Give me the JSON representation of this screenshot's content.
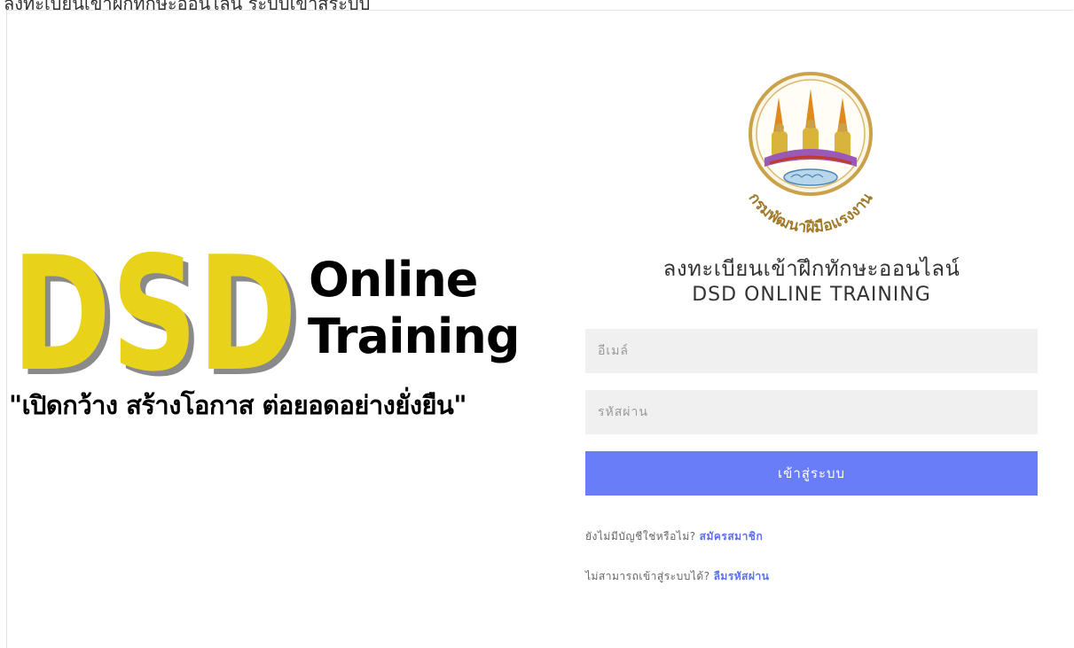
{
  "top_strip_text": "ลงทะเบียนเข้าฝึกทักษะออนไลน์ ระบบเข้าสู่ระบบ",
  "brand": {
    "logo_letters": "DSD",
    "line1": "Online",
    "line2": "Training",
    "tagline": "\"เปิดกว้าง สร้างโอกาส ต่อยอดอย่างยั่งยืน\""
  },
  "seal": {
    "arc_text": "กรมพัฒนาฝีมือแรงงาน"
  },
  "login": {
    "title_th": "ลงทะเบียนเข้าฝึกทักษะออนไลน์",
    "title_en": "DSD ONLINE TRAINING",
    "email_placeholder": "อีเมล์",
    "password_placeholder": "รหัสผ่าน",
    "submit_label": "เข้าสู่ระบบ",
    "no_account_text": "ยังไม่มีบัญชีใช่หรือไม่?",
    "register_link": "สมัครสมาชิก",
    "cannot_login_text": "ไม่สามารถเข้าสู่ระบบได้?",
    "forgot_link": "ลืมรหัสผ่าน"
  },
  "colors": {
    "accent": "#6a7df9",
    "link": "#5b6ff0",
    "logo_yellow": "#e9d31a",
    "seal_gold": "#c9a24a"
  }
}
